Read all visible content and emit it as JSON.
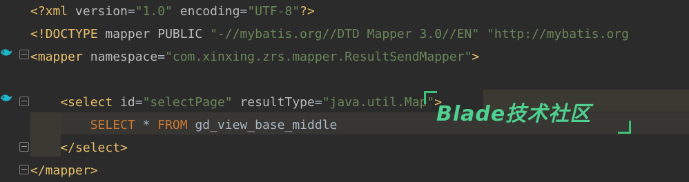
{
  "editor": {
    "lines": [
      {
        "parts": [
          {
            "t": "<?xml ",
            "c": "tag"
          },
          {
            "t": "version",
            "c": "attr"
          },
          {
            "t": "=",
            "c": "plain"
          },
          {
            "t": "\"1.0\"",
            "c": "val"
          },
          {
            "t": " ",
            "c": "plain"
          },
          {
            "t": "encoding",
            "c": "attr"
          },
          {
            "t": "=",
            "c": "plain"
          },
          {
            "t": "\"UTF-8\"",
            "c": "val"
          },
          {
            "t": "?>",
            "c": "tag"
          }
        ]
      },
      {
        "parts": [
          {
            "t": "<!DOCTYPE ",
            "c": "tag"
          },
          {
            "t": "mapper ",
            "c": "attr"
          },
          {
            "t": "PUBLIC ",
            "c": "attr"
          },
          {
            "t": "\"-//mybatis.org//DTD Mapper 3.0//EN\"",
            "c": "val"
          },
          {
            "t": " ",
            "c": "plain"
          },
          {
            "t": "\"http://mybatis.org",
            "c": "val"
          }
        ]
      },
      {
        "parts": [
          {
            "t": "<mapper ",
            "c": "tag"
          },
          {
            "t": "namespace",
            "c": "attr"
          },
          {
            "t": "=",
            "c": "plain"
          },
          {
            "t": "\"com.xinxing.zrs.mapper.ResultSendMapper\"",
            "c": "val"
          },
          {
            "t": ">",
            "c": "tag"
          }
        ]
      },
      {
        "parts": [
          {
            "t": " ",
            "c": "plain"
          }
        ]
      },
      {
        "parts": [
          {
            "t": "    <select ",
            "c": "tag"
          },
          {
            "t": "id",
            "c": "attr"
          },
          {
            "t": "=",
            "c": "plain"
          },
          {
            "t": "\"selectPage\"",
            "c": "val"
          },
          {
            "t": " ",
            "c": "plain"
          },
          {
            "t": "resultType",
            "c": "attr"
          },
          {
            "t": "=",
            "c": "plain"
          },
          {
            "t": "\"java.util.Map\"",
            "c": "val"
          },
          {
            "t": ">",
            "c": "tag"
          }
        ]
      },
      {
        "parts": [
          {
            "t": "        SELECT ",
            "c": "kw"
          },
          {
            "t": "* ",
            "c": "plain"
          },
          {
            "t": "FROM ",
            "c": "kw"
          },
          {
            "t": "gd_view_base_middle",
            "c": "plain"
          }
        ]
      },
      {
        "parts": [
          {
            "t": "    </select>",
            "c": "tag"
          }
        ]
      },
      {
        "parts": [
          {
            "t": "</mapper>",
            "c": "tag"
          }
        ]
      }
    ]
  },
  "watermark": {
    "text": "Blade技术社区"
  },
  "gutter_icons": {
    "mapper_icon": "mybatis-bird-icon",
    "select_icon": "mybatis-bird-icon",
    "fold_icon": "fold-icon"
  }
}
